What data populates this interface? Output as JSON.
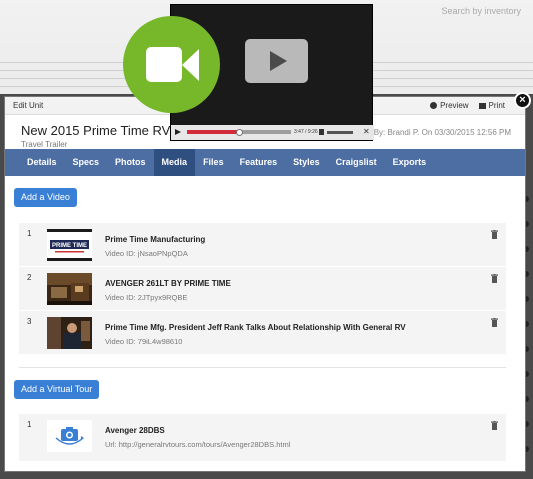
{
  "background": {
    "search_hint": "Search by inventory"
  },
  "modal": {
    "topbar": {
      "title": "Edit Unit",
      "preview_label": "Preview",
      "print_label": "Print"
    },
    "close_label": "×",
    "unit_title": "New 2015 Prime Time RV Avenger",
    "unit_subtitle": "Travel Trailer",
    "modified": "ified By: Brandi P. On 03/30/2015 12:56 PM",
    "tabs": [
      {
        "label": "Details"
      },
      {
        "label": "Specs"
      },
      {
        "label": "Photos"
      },
      {
        "label": "Media"
      },
      {
        "label": "Files"
      },
      {
        "label": "Features"
      },
      {
        "label": "Styles"
      },
      {
        "label": "Craigslist"
      },
      {
        "label": "Exports"
      }
    ],
    "active_tab": "Media",
    "add_video_label": "Add a Video",
    "videos": [
      {
        "num": "1",
        "title": "Prime Time Manufacturing",
        "sub": "Video ID: jNsaoPNpQDA",
        "thumb_text": "PRIME TIME"
      },
      {
        "num": "2",
        "title": "AVENGER 261LT BY PRIME TIME",
        "sub": "Video ID: 2JTpyx9RQBE"
      },
      {
        "num": "3",
        "title": "Prime Time Mfg. President Jeff Rank Talks About Relationship With General RV",
        "sub": "Video ID: 79iL4w98610"
      }
    ],
    "add_tour_label": "Add a Virtual Tour",
    "tours": [
      {
        "num": "1",
        "title": "Avenger 28DBS",
        "sub": "Url: http://generalrvtours.com/tours/Avenger28DBS.html"
      }
    ]
  },
  "player": {
    "time_label": "3:47 / 9:26",
    "close_label": "✕",
    "progress": 0.5
  },
  "colors": {
    "tab_bar": "#4d6ea3",
    "tab_active": "#2f4f80",
    "button_blue": "#3a7fd6",
    "camera_green": "#76b82a",
    "progress_red": "#d22c3a"
  },
  "icons": {
    "preview": "eye-icon",
    "print": "printer-icon",
    "trash": "trash-icon",
    "camera": "video-camera-icon",
    "play": "play-icon",
    "tour": "360-camera-icon"
  }
}
